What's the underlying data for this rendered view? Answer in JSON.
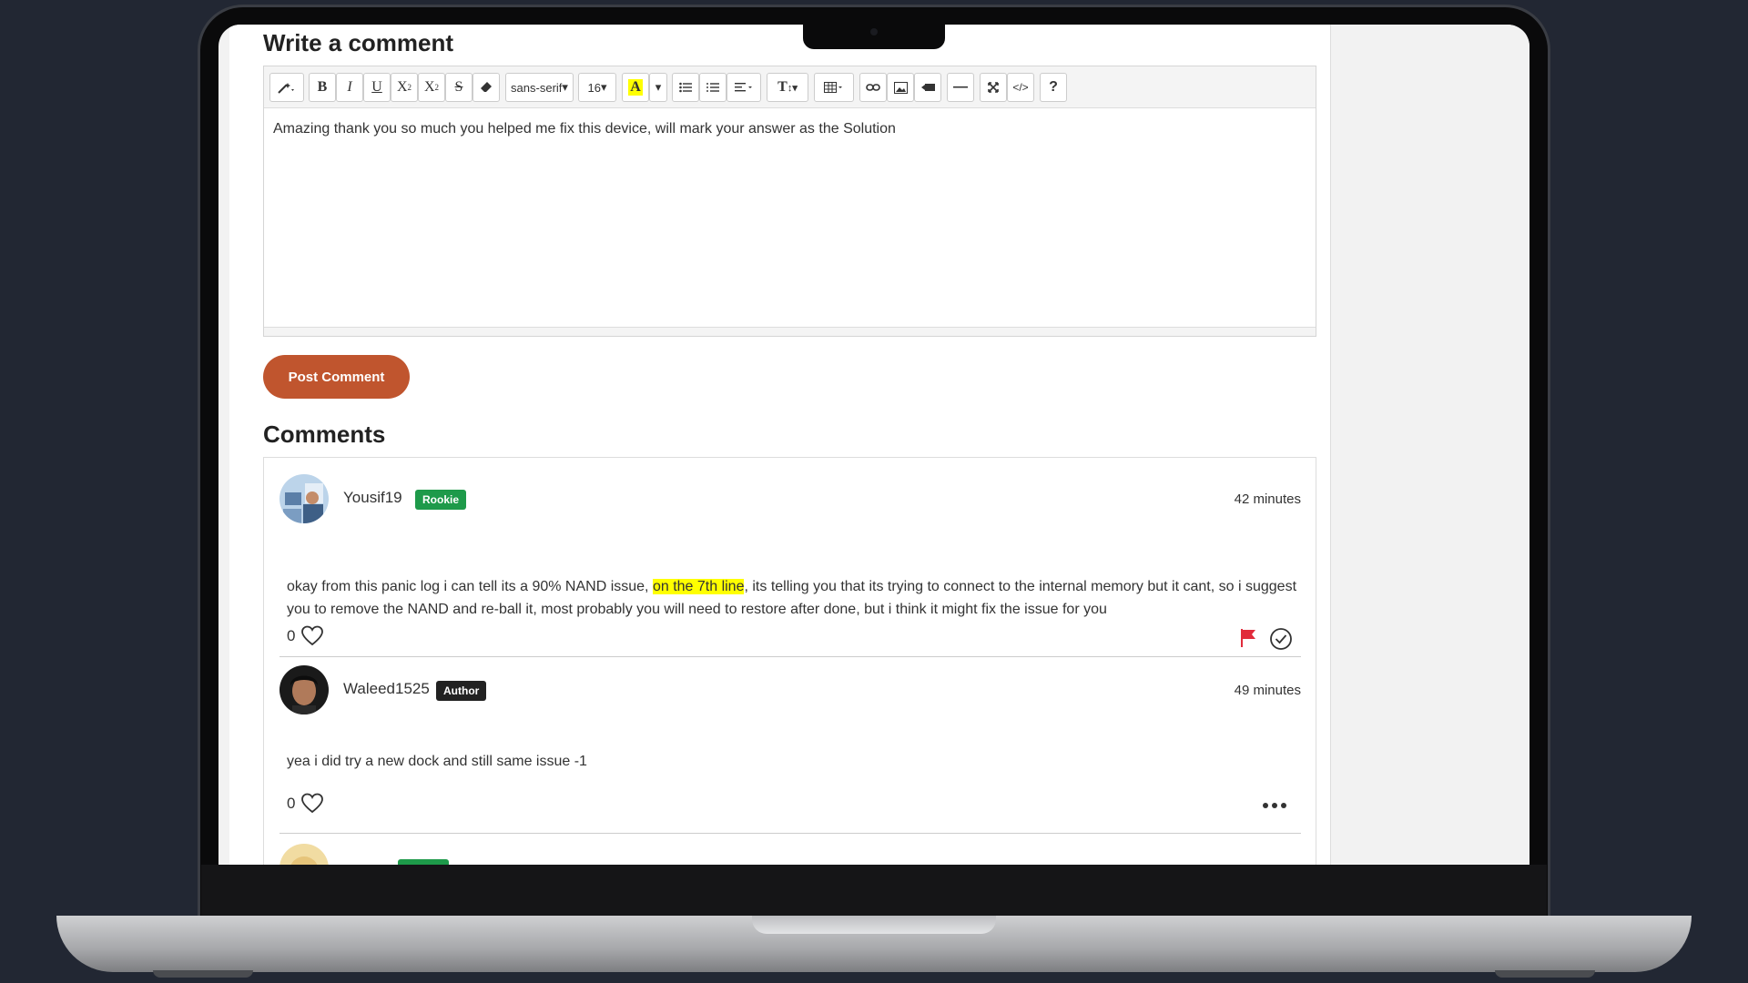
{
  "editor": {
    "title": "Write a comment",
    "font_family": "sans-serif",
    "font_size": "16",
    "content": "Amazing thank you so much you helped me fix this device, will mark your answer as the Solution",
    "post_label": "Post Comment"
  },
  "comments": {
    "title": "Comments",
    "items": [
      {
        "user": "Yousif19",
        "badge": "Rookie",
        "badge_color": "#1e9a4a",
        "time": "42 minutes",
        "text_before": "okay from this panic log i can tell its a 90% NAND issue, ",
        "text_highlight": "on the 7th line",
        "text_after": ", its telling you that its trying to connect to the internal memory but it cant, so i suggest you to remove the NAND and re-ball it, most probably you will need to restore after done, but i think it might fix the issue for you",
        "likes": "0"
      },
      {
        "user": "Waleed1525",
        "badge": "Author",
        "badge_color": "#222222",
        "time": "49 minutes",
        "text": "yea i did try a new dock and still same issue -1",
        "likes": "0"
      }
    ]
  }
}
